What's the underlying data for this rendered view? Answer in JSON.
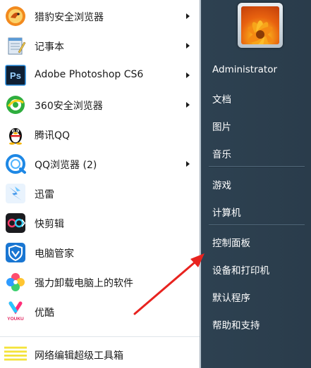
{
  "programs": [
    {
      "label": "猎豹安全浏览器",
      "icon": "cheetah-browser-icon",
      "has_submenu": true
    },
    {
      "label": "记事本",
      "icon": "notepad-icon",
      "has_submenu": true
    },
    {
      "label": "Adobe Photoshop CS6",
      "icon": "photoshop-icon",
      "has_submenu": true
    },
    {
      "label": "360安全浏览器",
      "icon": "360-browser-icon",
      "has_submenu": true
    },
    {
      "label": "腾讯QQ",
      "icon": "qq-penguin-icon",
      "has_submenu": false
    },
    {
      "label": "QQ浏览器 (2)",
      "icon": "qq-browser-icon",
      "has_submenu": true
    },
    {
      "label": "迅雷",
      "icon": "xunlei-icon",
      "has_submenu": false
    },
    {
      "label": "快剪辑",
      "icon": "kuaijianji-icon",
      "has_submenu": false
    },
    {
      "label": "电脑管家",
      "icon": "pc-manager-shield-icon",
      "has_submenu": false
    },
    {
      "label": "强力卸载电脑上的软件",
      "icon": "uninstaller-icon",
      "has_submenu": false
    },
    {
      "label": "优酷",
      "icon": "youku-icon",
      "has_submenu": false
    }
  ],
  "bottom_item": {
    "label": "网络编辑超级工具箱",
    "icon": "toolbox-icon"
  },
  "icon_text": {
    "photoshop": "Ps",
    "youku": "YOUKU"
  },
  "user": {
    "name": "Administrator",
    "avatar": "flower-avatar"
  },
  "right_items": [
    {
      "label": "文档"
    },
    {
      "label": "图片"
    },
    {
      "label": "音乐"
    },
    {
      "label": "游戏"
    },
    {
      "label": "计算机"
    },
    {
      "label": "控制面板"
    },
    {
      "label": "设备和打印机"
    },
    {
      "label": "默认程序"
    },
    {
      "label": "帮助和支持"
    }
  ],
  "colors": {
    "right_panel_bg": "#34495a",
    "left_panel_bg": "#ffffff",
    "annotation_arrow": "#e8231f"
  }
}
